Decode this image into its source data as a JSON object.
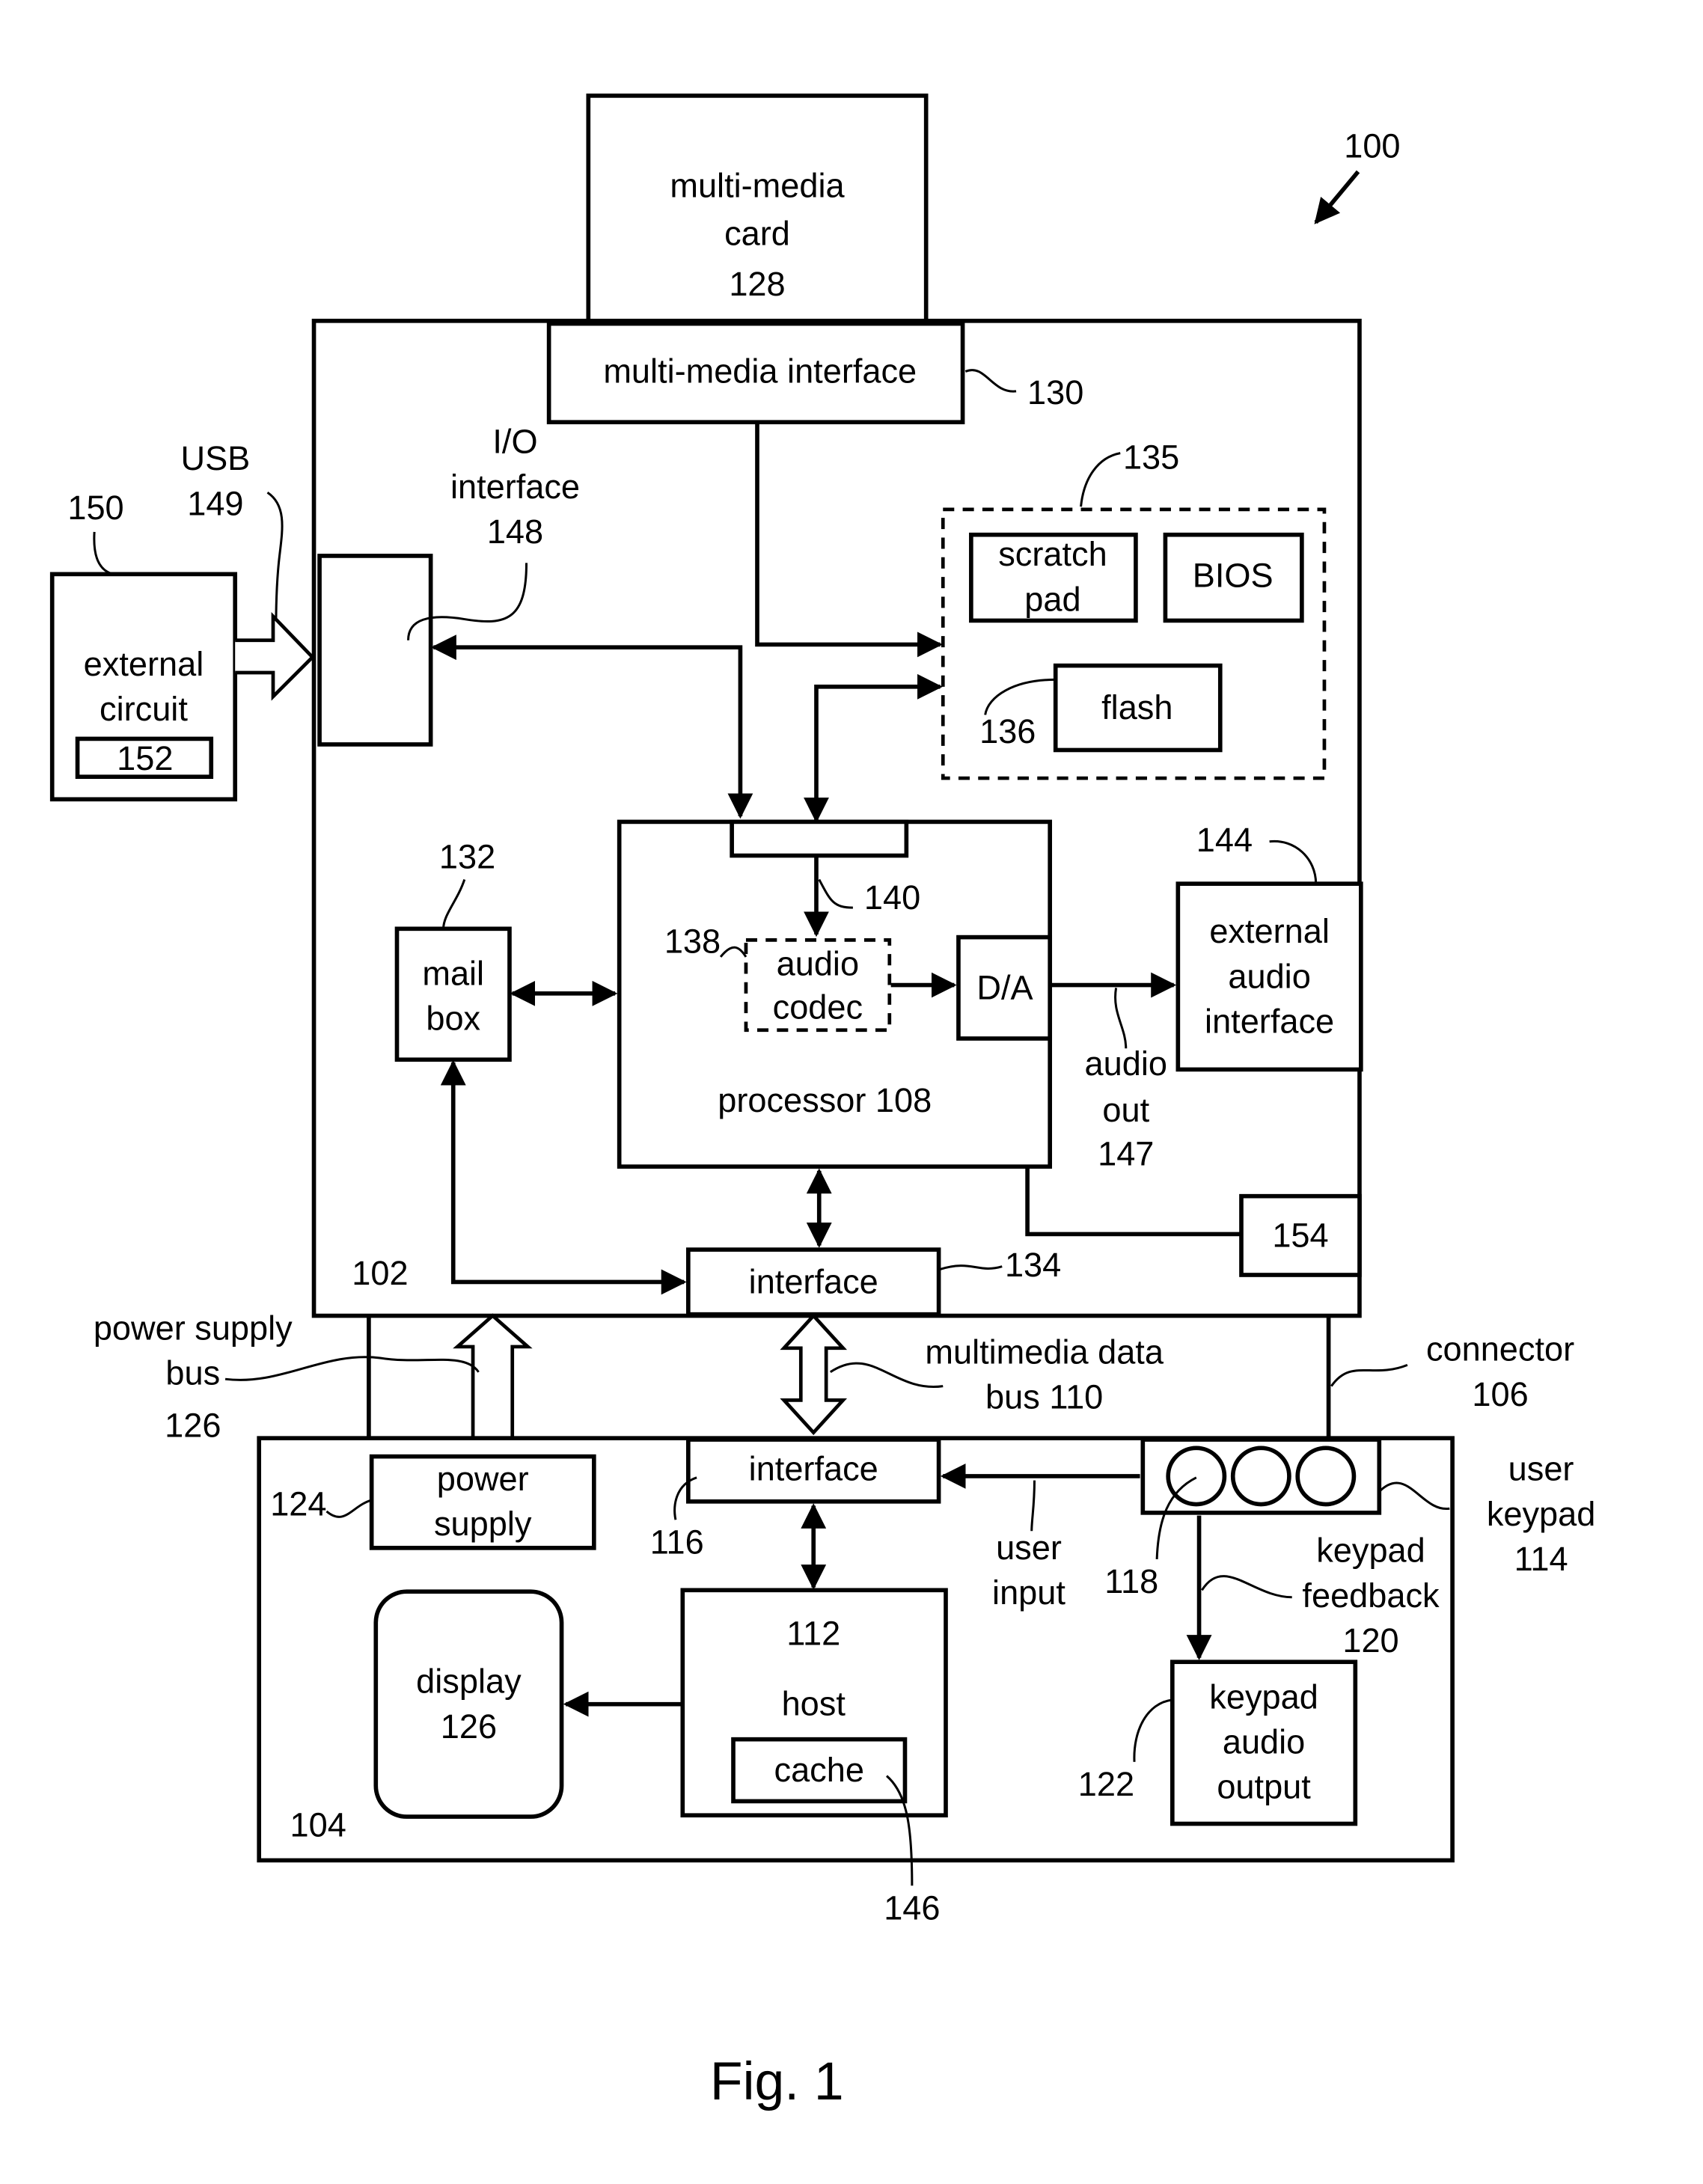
{
  "figure": {
    "caption": "Fig. 1",
    "ref": "100"
  },
  "multimedia_card": {
    "l1": "multi-media",
    "l2": "card",
    "ref": "128"
  },
  "multimedia_interface": {
    "label": "multi-media interface",
    "ref": "130"
  },
  "device_block": {
    "ref": "102"
  },
  "io_interface": {
    "l1": "I/O",
    "l2": "interface",
    "ref": "148"
  },
  "usb": {
    "label": "USB",
    "ref": "149"
  },
  "external_circuit": {
    "l1": "external",
    "l2": "circuit",
    "ref": "150",
    "inner_ref": "152"
  },
  "memory_group": {
    "ref": "135",
    "scratch_l1": "scratch",
    "scratch_l2": "pad",
    "bios": "BIOS",
    "flash": "flash",
    "flash_ref": "136"
  },
  "mailbox": {
    "l1": "mail",
    "l2": "box",
    "ref": "132"
  },
  "processor": {
    "label": "processor 108",
    "port_ref": "140"
  },
  "audio_codec": {
    "l1": "audio",
    "l2": "codec",
    "ref": "138"
  },
  "da": {
    "label": "D/A"
  },
  "external_audio": {
    "l1": "external",
    "l2": "audio",
    "l3": "interface",
    "ref": "144"
  },
  "audio_out": {
    "l1": "audio",
    "l2": "out",
    "ref": "147"
  },
  "block_154": {
    "ref": "154"
  },
  "interface_134": {
    "label": "interface",
    "ref": "134"
  },
  "power_bus": {
    "l1": "power supply",
    "l2": "bus",
    "ref": "126"
  },
  "multimedia_bus": {
    "l1": "multimedia data",
    "l2": "bus 110"
  },
  "connector": {
    "label": "connector",
    "ref": "106"
  },
  "host_block": {
    "ref": "104"
  },
  "power_supply": {
    "l1": "power",
    "l2": "supply",
    "ref": "124"
  },
  "interface_116": {
    "label": "interface",
    "ref": "116"
  },
  "user_input": {
    "l1": "user",
    "l2": "input"
  },
  "keypad": {
    "ref_buttons": "118",
    "l1": "user",
    "l2": "keypad",
    "ref": "114"
  },
  "keypad_feedback": {
    "l1": "keypad",
    "l2": "feedback",
    "ref": "120"
  },
  "keypad_audio": {
    "l1": "keypad",
    "l2": "audio",
    "l3": "output",
    "ref": "122"
  },
  "display": {
    "l1": "display",
    "l2": "126"
  },
  "host": {
    "ref": "112",
    "label": "host",
    "cache": "cache",
    "cache_ref": "146"
  }
}
